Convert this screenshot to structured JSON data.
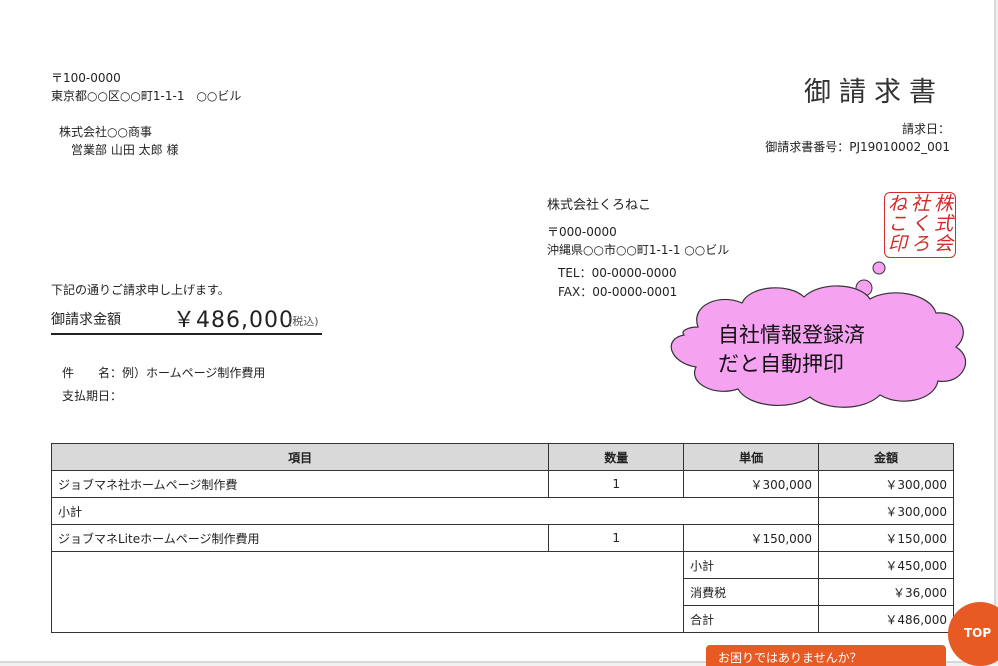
{
  "recipient_address": {
    "postal": "〒100-0000",
    "address": "東京都○○区○○町1-1-1　○○ビル"
  },
  "recipient": {
    "company": "株式会社○○商事",
    "person": "営業部 山田 太郎 様"
  },
  "doc_title": "御請求書",
  "meta": {
    "date_label": "請求日：",
    "number_label": "御請求書番号：PJ19010002_001"
  },
  "issuer": {
    "company": "株式会社くろねこ",
    "postal": "〒000-0000",
    "address": "沖縄県○○市○○町1-1-1 ○○ビル",
    "tel": "TEL：00-0000-0000",
    "fax": "FAX：00-0000-0001"
  },
  "stamp": {
    "chars": [
      "株",
      "式",
      "会",
      "社",
      "く",
      "ろ",
      "ね",
      "こ",
      "印"
    ]
  },
  "callout": {
    "line1": "自社情報登録済",
    "line2": "だと自動押印"
  },
  "intro": "下記の通りご請求申し上げます。",
  "total": {
    "label": "御請求金額",
    "value": "￥486,000",
    "tax_note": "(税込)"
  },
  "details": {
    "subject": "件　　名：例）ホームページ制作費用",
    "due": "支払期日："
  },
  "table": {
    "headers": [
      "項目",
      "数量",
      "単価",
      "金額"
    ],
    "rows": [
      {
        "item": "ジョブマネ社ホームページ制作費",
        "qty": "1",
        "unit": "￥300,000",
        "amount": "￥300,000"
      },
      {
        "subtotal_label": "小計",
        "amount": "￥300,000"
      },
      {
        "item": "ジョブマネLiteホームページ制作費用",
        "qty": "1",
        "unit": "￥150,000",
        "amount": "￥150,000"
      }
    ],
    "summary": [
      {
        "label": "小計",
        "value": "￥450,000"
      },
      {
        "label": "消費税",
        "value": "￥36,000"
      },
      {
        "label": "合計",
        "value": "￥486,000"
      }
    ]
  },
  "ui": {
    "top_button": "TOP",
    "help": "お困りではありませんか？",
    "accent": "#e85a24",
    "stamp_color": "#d42a2a",
    "bubble_color": "#f5a3f0"
  }
}
